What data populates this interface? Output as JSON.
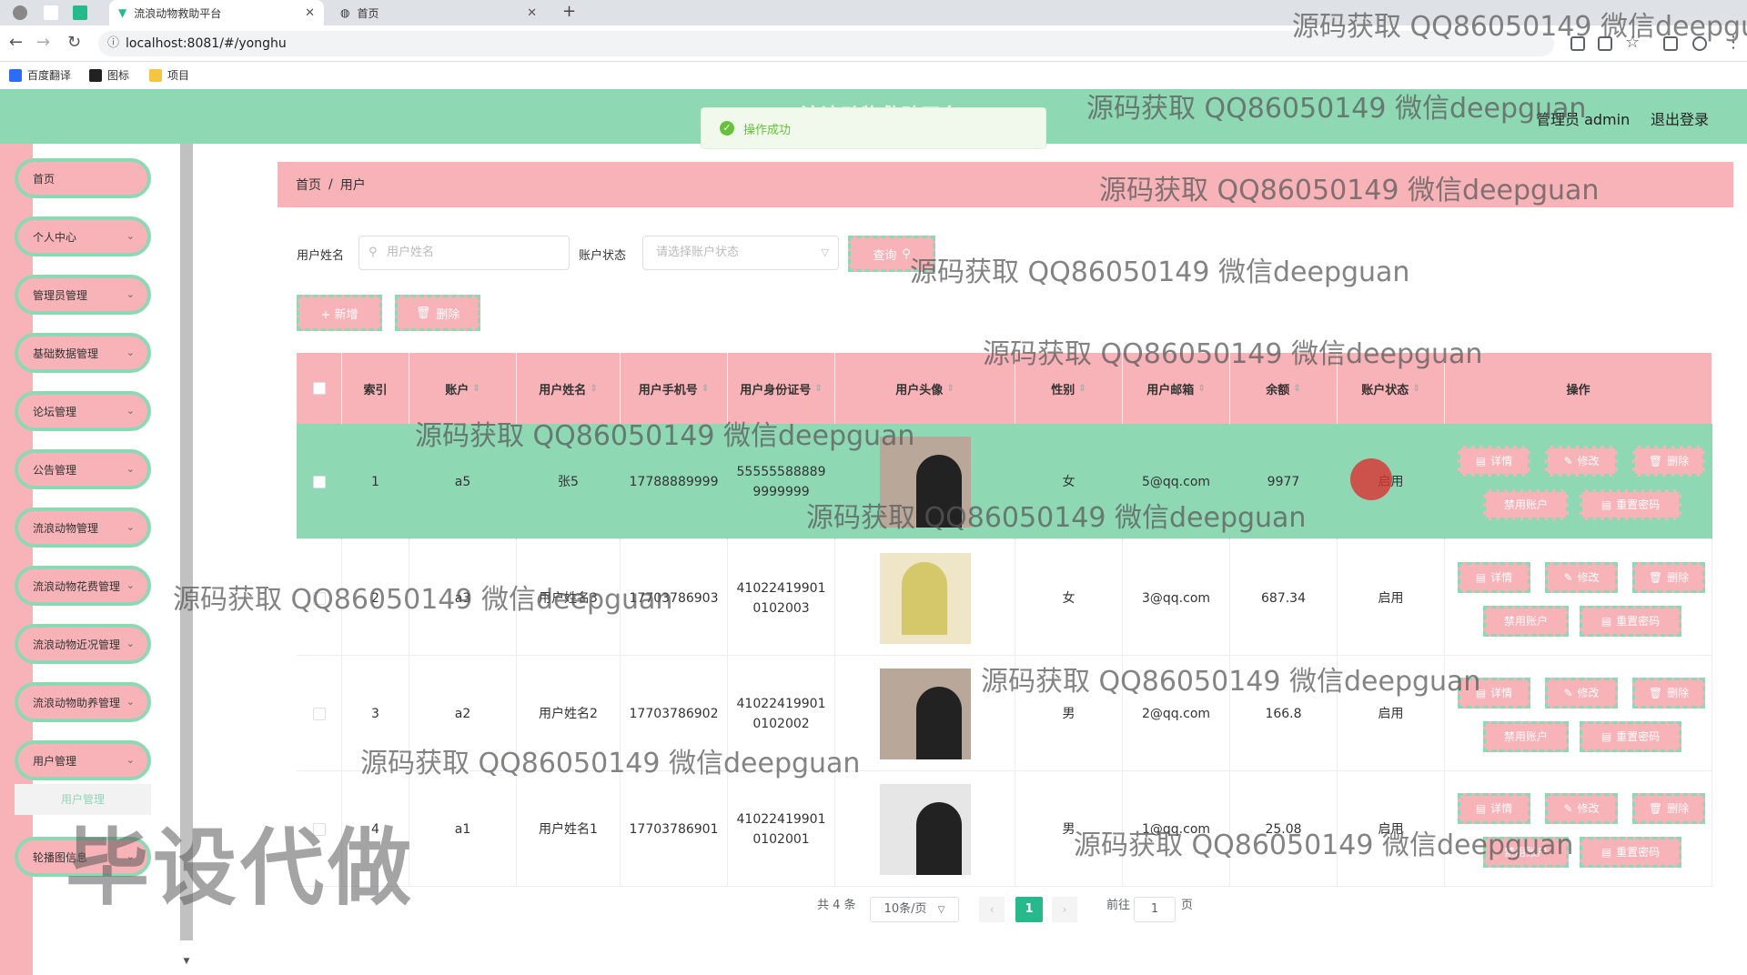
{
  "browser": {
    "tabs": [
      {
        "label": "流浪动物救助平台",
        "active": true
      },
      {
        "label": "首页",
        "active": false
      }
    ],
    "url": "localhost:8081/#/yonghu",
    "bookmarks": [
      "百度翻译",
      "图标",
      "项目"
    ]
  },
  "header": {
    "title": "流浪动物救助平台",
    "admin_label": "管理员 admin",
    "logout_label": "退出登录"
  },
  "toast": {
    "message": "操作成功"
  },
  "sidebar": {
    "items": [
      {
        "label": "首页",
        "expandable": false
      },
      {
        "label": "个人中心",
        "expandable": true
      },
      {
        "label": "管理员管理",
        "expandable": true
      },
      {
        "label": "基础数据管理",
        "expandable": true
      },
      {
        "label": "论坛管理",
        "expandable": true
      },
      {
        "label": "公告管理",
        "expandable": true
      },
      {
        "label": "流浪动物管理",
        "expandable": true
      },
      {
        "label": "流浪动物花费管理",
        "expandable": true
      },
      {
        "label": "流浪动物近况管理",
        "expandable": true
      },
      {
        "label": "流浪动物助养管理",
        "expandable": true
      },
      {
        "label": "用户管理",
        "expandable": true
      },
      {
        "label": "轮播图信息",
        "expandable": true
      }
    ],
    "active_sub": "用户管理"
  },
  "breadcrumb": {
    "home": "首页",
    "sep": "/",
    "current": "用户"
  },
  "search": {
    "name_label": "用户姓名",
    "name_placeholder": "用户姓名",
    "status_label": "账户状态",
    "status_placeholder": "请选择账户状态",
    "query_button": "查询"
  },
  "toolbar": {
    "add": "+ 新增",
    "delete": "删除"
  },
  "table": {
    "headers": [
      "索引",
      "账户",
      "用户姓名",
      "用户手机号",
      "用户身份证号",
      "用户头像",
      "性别",
      "用户邮箱",
      "余额",
      "账户状态",
      "操作"
    ],
    "rows": [
      {
        "index": "1",
        "account": "a5",
        "name": "张5",
        "phone": "17788889999",
        "id_line1": "55555588889",
        "id_line2": "9999999",
        "gender": "女",
        "email": "5@qq.com",
        "balance": "9977",
        "status": "启用",
        "highlighted": true
      },
      {
        "index": "2",
        "account": "a3",
        "name": "用户姓名3",
        "phone": "17703786903",
        "id_line1": "41022419901",
        "id_line2": "0102003",
        "gender": "女",
        "email": "3@qq.com",
        "balance": "687.34",
        "status": "启用",
        "highlighted": false
      },
      {
        "index": "3",
        "account": "a2",
        "name": "用户姓名2",
        "phone": "17703786902",
        "id_line1": "41022419901",
        "id_line2": "0102002",
        "gender": "男",
        "email": "2@qq.com",
        "balance": "166.8",
        "status": "启用",
        "highlighted": false
      },
      {
        "index": "4",
        "account": "a1",
        "name": "用户姓名1",
        "phone": "17703786901",
        "id_line1": "41022419901",
        "id_line2": "0102001",
        "gender": "男",
        "email": "1@qq.com",
        "balance": "25.08",
        "status": "启用",
        "highlighted": false
      }
    ],
    "actions": {
      "detail": "详情",
      "edit": "修改",
      "delete": "删除",
      "disable": "禁用账户",
      "reset": "重置密码"
    }
  },
  "pagination": {
    "total": "共 4 条",
    "page_size": "10条/页",
    "current_page": "1",
    "goto_label": "前往",
    "goto_value": "1",
    "page_suffix": "页"
  },
  "overlays": {
    "watermark": "源码获取 QQ86050149 微信deepguan",
    "big_watermark": "毕设代做"
  },
  "colors": {
    "primary_pink": "#f7b3b8",
    "primary_green": "#8ed8b4",
    "page_active": "#26b98a"
  }
}
